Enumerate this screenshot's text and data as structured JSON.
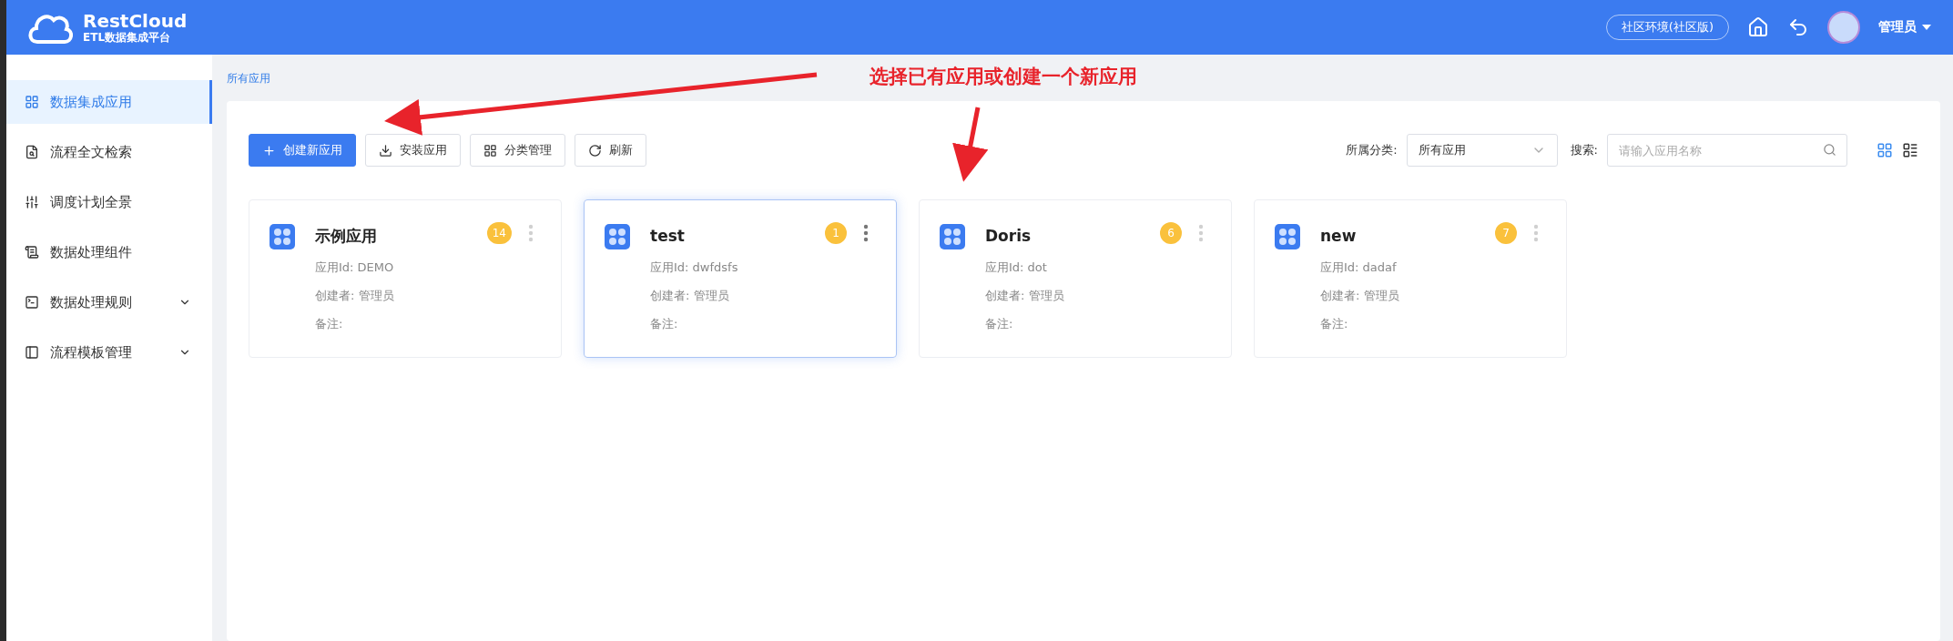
{
  "header": {
    "logo_title": "RestCloud",
    "logo_subtitle": "ETL数据集成平台",
    "env_badge": "社区环境(社区版)",
    "user_name": "管理员"
  },
  "sidebar": {
    "items": [
      {
        "label": "数据集成应用",
        "selected": true,
        "expandable": false
      },
      {
        "label": "流程全文检索",
        "selected": false,
        "expandable": false
      },
      {
        "label": "调度计划全景",
        "selected": false,
        "expandable": false
      },
      {
        "label": "数据处理组件",
        "selected": false,
        "expandable": false
      },
      {
        "label": "数据处理规则",
        "selected": false,
        "expandable": true
      },
      {
        "label": "流程模板管理",
        "selected": false,
        "expandable": true
      }
    ]
  },
  "breadcrumb": "所有应用",
  "toolbar": {
    "buttons": [
      {
        "label": "创建新应用",
        "kind": "primary"
      },
      {
        "label": "安装应用",
        "kind": "install"
      },
      {
        "label": "分类管理",
        "kind": "category"
      },
      {
        "label": "刷新",
        "kind": "refresh"
      }
    ],
    "filter": {
      "label": "所属分类:",
      "value": "所有应用"
    },
    "search": {
      "label": "搜索:",
      "placeholder": "请输入应用名称"
    },
    "view_toggle": [
      {
        "kind": "grid",
        "selected": true
      },
      {
        "kind": "list",
        "selected": false
      }
    ]
  },
  "cards": [
    {
      "name": "示例应用",
      "count": "14",
      "id_line": "应用Id: DEMO",
      "creator_line": "创建者: 管理员",
      "note_line": "备注:",
      "selected": false
    },
    {
      "name": "test",
      "count": "1",
      "id_line": "应用Id: dwfdsfs",
      "creator_line": "创建者: 管理员",
      "note_line": "备注:",
      "selected": true
    },
    {
      "name": "Doris",
      "count": "6",
      "id_line": "应用Id: dot",
      "creator_line": "创建者: 管理员",
      "note_line": "备注:",
      "selected": false
    },
    {
      "name": "new",
      "count": "7",
      "id_line": "应用Id: dadaf",
      "creator_line": "创建者: 管理员",
      "note_line": "备注:",
      "selected": false
    }
  ],
  "annotation": {
    "text": "选择已有应用或创建一个新应用"
  }
}
